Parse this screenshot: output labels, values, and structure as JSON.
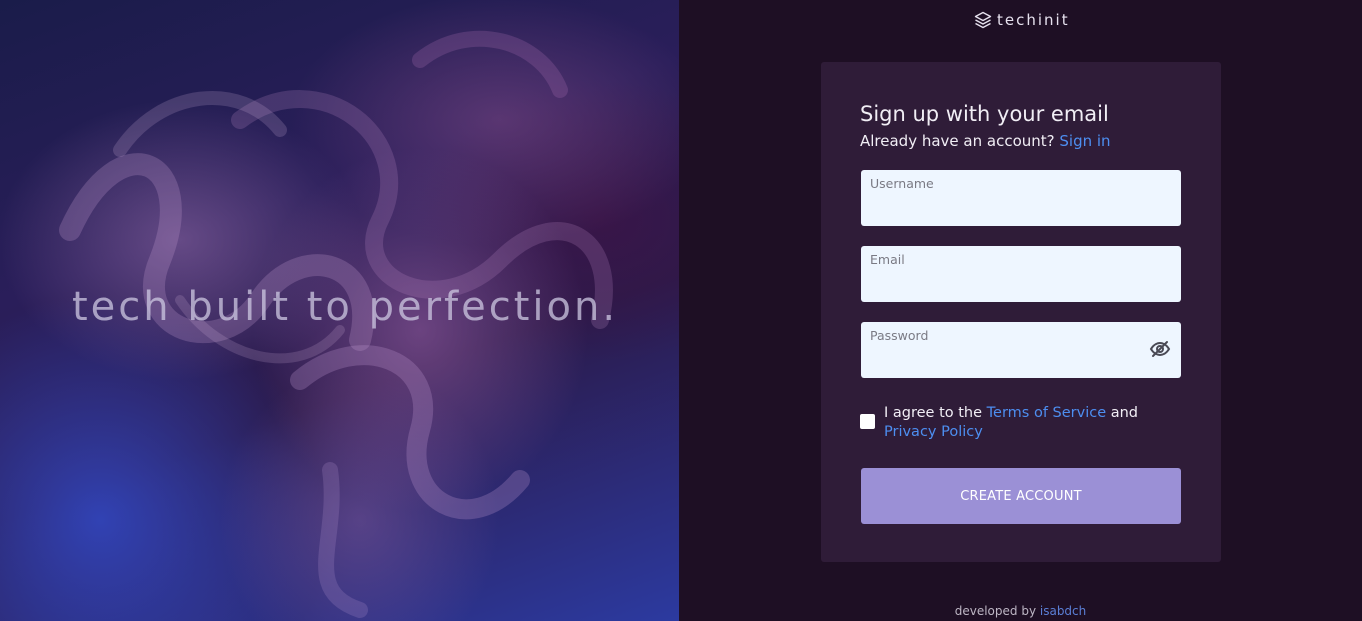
{
  "hero": {
    "tagline": "tech built to perfection."
  },
  "brand": {
    "name": "techinit",
    "icon": "layers-icon"
  },
  "signup": {
    "title": "Sign up with your email",
    "account_prompt": "Already have an account?",
    "signin_link": "Sign in",
    "fields": {
      "username": {
        "label": "Username",
        "value": ""
      },
      "email": {
        "label": "Email",
        "value": ""
      },
      "password": {
        "label": "Password",
        "value": "",
        "toggle_icon": "eye-off-icon"
      }
    },
    "agree": {
      "prefix": "I agree to the",
      "terms_link": "Terms of Service",
      "conjunction": "and",
      "privacy_link": "Privacy Policy",
      "checked": false
    },
    "submit_label": "CREATE ACCOUNT"
  },
  "footer": {
    "prefix": "developed by",
    "author_link": "isabdch"
  },
  "colors": {
    "page_bg": "#1e0f24",
    "card_bg": "#2f1c38",
    "input_bg": "#eef6ff",
    "link": "#4d8ef0",
    "button": "#9b90d6"
  }
}
